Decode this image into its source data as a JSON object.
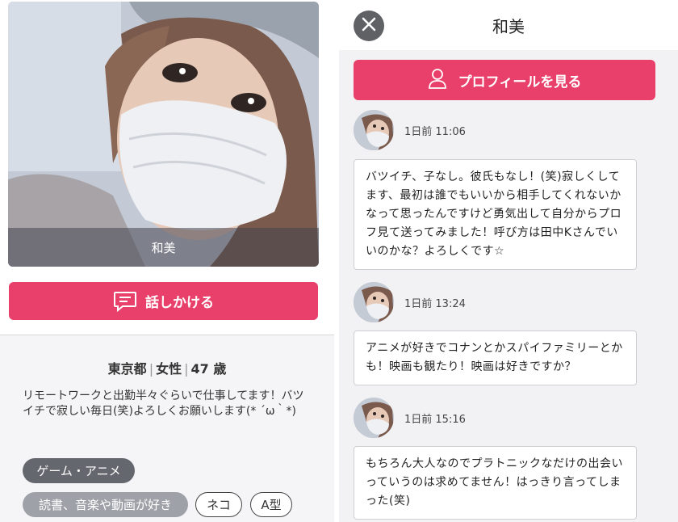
{
  "left": {
    "photo_name": "和美",
    "talk_button": "話しかける",
    "location": "東京都",
    "gender": "女性",
    "age": "47 歳",
    "bio": "リモートワークと出勤半々ぐらいで仕事してます！バツイチで寂しい毎日(笑)よろしくお願いします(* ´ω｀*)",
    "tags": [
      "ゲーム・アニメ",
      "読書、音楽や動画が好き",
      "ネコ",
      "A型"
    ]
  },
  "right": {
    "title": "和美",
    "profile_button": "プロフィールを見る",
    "messages": [
      {
        "time": "1日前 11:06",
        "text": "バツイチ、子なし。彼氏もなし！(笑)寂しくしてます、最初は誰でもいいから相手してくれないかなって思ったんですけど勇気出して自分からプロフ見て送ってみました！呼び方は田中Kさんでいいのかな？よろしくです☆"
      },
      {
        "time": "1日前 13:24",
        "text": "アニメが好きでコナンとかスパイファミリーとかも！映画も観たり！映画は好きですか？"
      },
      {
        "time": "1日前 15:16",
        "text": "もちろん大人なのでプラトニックなだけの出会いっていうのは求めてません！はっきり言ってしまった(笑)"
      }
    ]
  },
  "colors": {
    "accent": "#e8406a",
    "close_bg": "#5f6165",
    "tag_dark": "#64686e",
    "tag_gray": "#9ea2a8"
  },
  "icons": {
    "talk": "chat-bubble-icon",
    "profile": "person-icon",
    "close": "close-icon"
  }
}
